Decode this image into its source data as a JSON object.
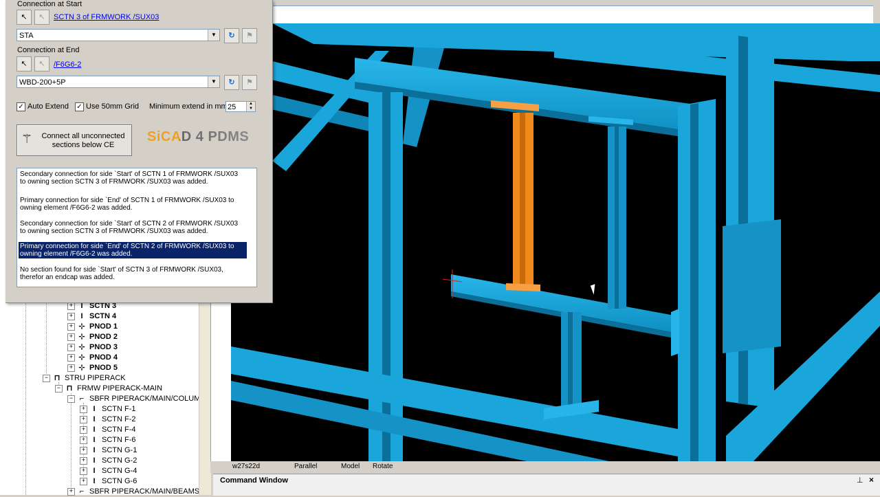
{
  "dialog": {
    "connection_start_label": "Connection at Start",
    "connection_start_link": "SCTN 3 of FRMWORK /SUX03",
    "start_type": "STA",
    "connection_end_label": "Connection at End",
    "connection_end_link": "/F6G6-2",
    "end_type": "WBD-200+5P",
    "auto_extend_label": "Auto Extend",
    "use_grid_label": "Use 50mm Grid",
    "min_extend_label": "Minimum extend in mm",
    "min_extend_value": "25",
    "connect_button": "Connect all unconnected sections below CE",
    "logo_text": "SiCAD 4 PDMS",
    "log": [
      "Secondary connection for side `Start' of SCTN 1 of FRMWORK /SUX03 to owning section SCTN 3 of FRMWORK /SUX03 was added.",
      "Primary connection for side `End' of SCTN 1 of FRMWORK /SUX03 to owning element /F6G6-2 was added.",
      "Secondary connection for side `Start' of SCTN 2 of FRMWORK /SUX03 to owning section SCTN 3 of FRMWORK /SUX03 was added.",
      "Primary connection for side `End' of SCTN 2 of FRMWORK /SUX03 to owning element /F6G6-2 was added.",
      "No section found for side `Start' of SCTN 3 of FRMWORK /SUX03, therefor an endcap was added."
    ]
  },
  "tree": {
    "rows": [
      {
        "label": "SCTN 3",
        "bold": true
      },
      {
        "label": "SCTN 4",
        "bold": true
      },
      {
        "label": "PNOD 1",
        "bold": true
      },
      {
        "label": "PNOD 2",
        "bold": true
      },
      {
        "label": "PNOD 3",
        "bold": true
      },
      {
        "label": "PNOD 4",
        "bold": true
      },
      {
        "label": "PNOD 5",
        "bold": true
      },
      {
        "label": "STRU PIPERACK",
        "bold": false
      },
      {
        "label": "FRMW PIPERACK-MAIN",
        "bold": false
      },
      {
        "label": "SBFR PIPERACK/MAIN/COLUMN",
        "bold": false
      },
      {
        "label": "SCTN F-1",
        "bold": false
      },
      {
        "label": "SCTN F-2",
        "bold": false
      },
      {
        "label": "SCTN F-4",
        "bold": false
      },
      {
        "label": "SCTN F-6",
        "bold": false
      },
      {
        "label": "SCTN G-1",
        "bold": false
      },
      {
        "label": "SCTN G-2",
        "bold": false
      },
      {
        "label": "SCTN G-4",
        "bold": false
      },
      {
        "label": "SCTN G-6",
        "bold": false
      },
      {
        "label": "SBFR PIPERACK/MAIN/BEAMS",
        "bold": false
      }
    ]
  },
  "viewport": {
    "status": [
      "w27s22d",
      "Parallel",
      "Model",
      "Rotate"
    ]
  },
  "command_window": {
    "title": "Command Window"
  },
  "colors": {
    "beam": "#1aa6db",
    "beam_dark": "#0a6f99",
    "highlight": "#f08a1c",
    "selection": "#0a246a"
  }
}
